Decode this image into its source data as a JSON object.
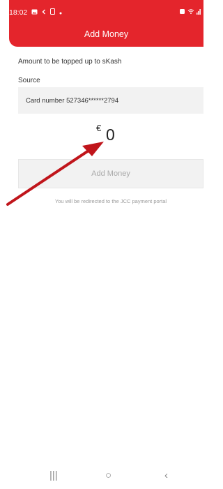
{
  "status_bar": {
    "time": "18:02",
    "left_icons": [
      "gallery-icon",
      "back-icon",
      "screenshot-icon",
      "dot-icon"
    ],
    "right_icons": [
      "alarm-icon",
      "wifi-icon",
      "signal-icon"
    ]
  },
  "header": {
    "title": "Add Money",
    "color": "#e4252c"
  },
  "form": {
    "amount_label": "Amount to be topped up to sKash",
    "source_label": "Source",
    "source_value": "Card number 527346******2794",
    "currency": "€",
    "amount": "0",
    "button_label": "Add Money",
    "redirect_note": "You will be redirected to the JCC payment portal"
  },
  "annotation": {
    "type": "red-arrow",
    "color": "#c0151b"
  },
  "nav_bar": {
    "recent_glyph": "|||",
    "home_glyph": "○",
    "back_glyph": "‹"
  }
}
